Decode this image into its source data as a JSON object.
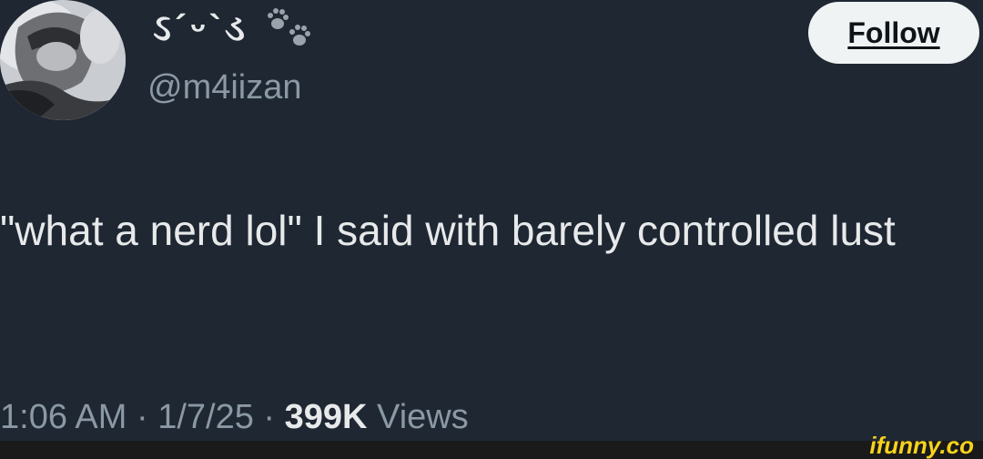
{
  "user": {
    "display_name": "ઽ´ᵕ`ડ",
    "decoration_icon": "paw-prints-icon",
    "handle": "@m4iizan",
    "avatar_icon": "avatar-photo"
  },
  "follow_button": {
    "label": "Follow"
  },
  "tweet": {
    "text": "\"what a nerd lol\" I said with barely controlled lust"
  },
  "meta": {
    "time": "1:06 AM",
    "separator": "·",
    "date": "1/7/25",
    "views_count": "399K",
    "views_label": "Views"
  },
  "watermark": {
    "text": "ifunny.co"
  },
  "colors": {
    "background": "#1e2732",
    "primary_text": "#e7e9ea",
    "secondary_text": "#8b98a5",
    "button_bg": "#eff3f4",
    "watermark": "#f7d21c"
  }
}
